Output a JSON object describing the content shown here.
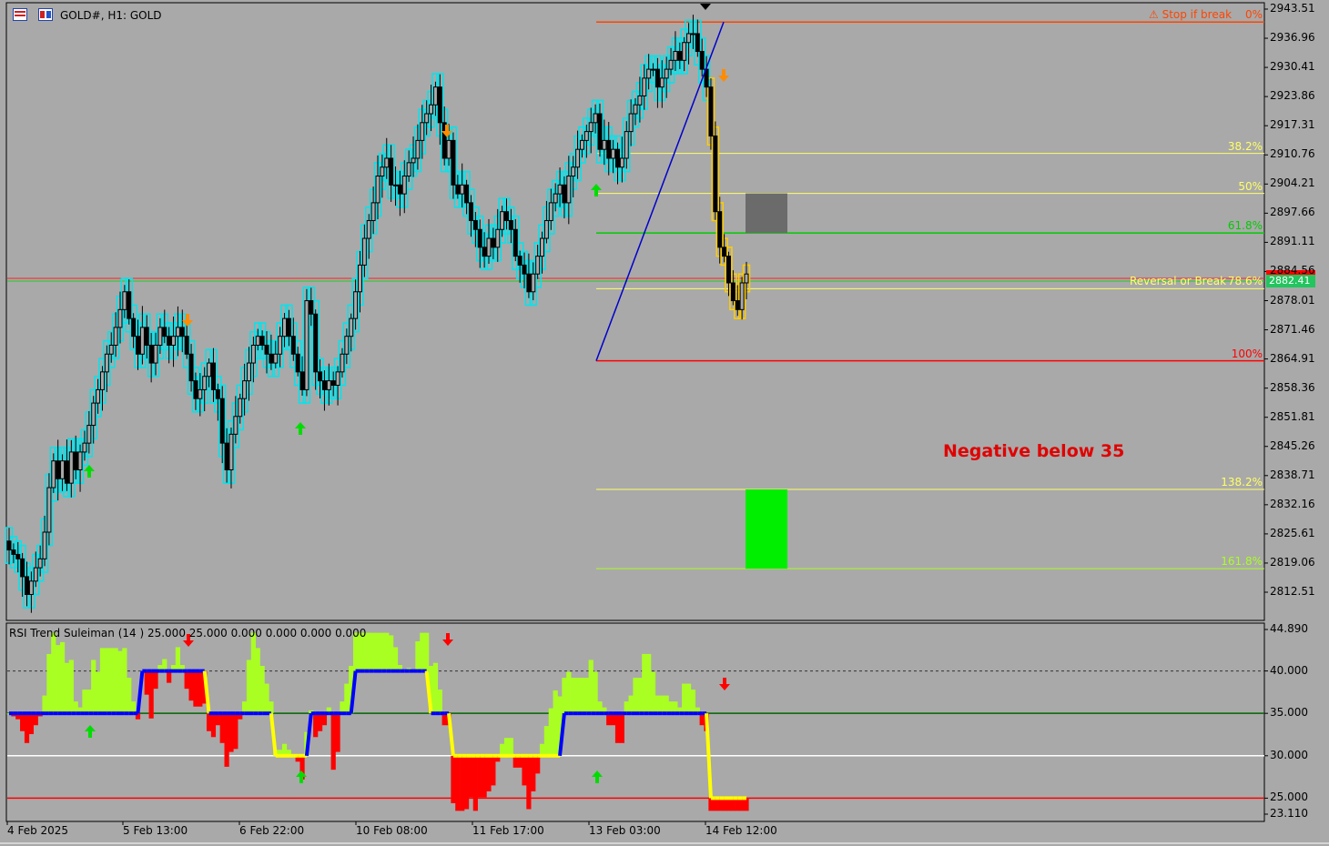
{
  "window": {
    "title": "GOLD#, H1:  GOLD",
    "icons": [
      "chart-window-icon",
      "chart-tile-icon"
    ]
  },
  "colors": {
    "background": "#a9a9a9",
    "envelope": "#00e5ee",
    "candle": "#000000",
    "fib_yellow": "#ffff66",
    "fib_green": "#00cc00",
    "fib_red": "#ff0000",
    "trend_line": "#0000cc",
    "buy_zone": "#00ee00",
    "entry_zone": "#6b6b6b",
    "rsi_positive": "#aaff22",
    "rsi_negative": "#ff0000",
    "rsi_trend_up": "#0000ff",
    "rsi_trend_down": "#ffff00",
    "arrow_up": "#00dd00",
    "arrow_down": "#ff8c00",
    "annotation": "#e00000"
  },
  "price_axis": [
    "2943.51",
    "2936.96",
    "2930.41",
    "2923.86",
    "2917.31",
    "2910.76",
    "2904.21",
    "2897.66",
    "2891.11",
    "2884.56",
    "2878.01",
    "2871.46",
    "2864.91",
    "2858.36",
    "2851.81",
    "2845.26",
    "2838.71",
    "2832.16",
    "2825.61",
    "2819.06",
    "2812.51"
  ],
  "current_price": "2882.41",
  "fibonacci": [
    {
      "pct": "0%",
      "note": "⚠ Stop if break",
      "color": "#ff4500",
      "price": 2940.6
    },
    {
      "pct": "38.2%",
      "note": "",
      "color": "#ffff66",
      "price": 2911.1
    },
    {
      "pct": "50%",
      "note": "",
      "color": "#ffff66",
      "price": 2902.1
    },
    {
      "pct": "61.8%",
      "note": "",
      "color": "#00cc00",
      "price": 2893.2
    },
    {
      "pct": "78.6%",
      "note": "Reversal or Break",
      "color": "#ffff66",
      "price": 2880.7
    },
    {
      "pct": "100%",
      "note": "",
      "color": "#ff0000",
      "price": 2864.5
    },
    {
      "pct": "138.2%",
      "note": "",
      "color": "#ffff66",
      "price": 2835.6
    },
    {
      "pct": "161.8%",
      "note": "",
      "color": "#aaff22",
      "price": 2817.8
    }
  ],
  "annotation": "Negative below 35",
  "oscillator": {
    "title": "RSI Trend Suleiman (14 ) 25.000 25.000 0.000 0.000 0.000 0.000",
    "axis": [
      "44.890",
      "40.000",
      "35.000",
      "30.000",
      "25.000",
      "23.110"
    ],
    "levels": [
      40,
      35,
      30,
      25
    ]
  },
  "time_axis": [
    "4 Feb 2025",
    "5 Feb 13:00",
    "6 Feb 22:00",
    "10 Feb 08:00",
    "11 Feb 17:00",
    "13 Feb 03:00",
    "14 Feb 12:00"
  ],
  "chart_data": {
    "type": "candlestick",
    "series": [
      {
        "values": [
          2822,
          2821,
          2820,
          2816,
          2812,
          2815,
          2818,
          2820,
          2826,
          2836,
          2842,
          2838,
          2842,
          2837,
          2844,
          2840,
          2844,
          2846,
          2850,
          2855,
          2858,
          2862,
          2866,
          2868,
          2872,
          2876,
          2880,
          2874,
          2870,
          2866,
          2872,
          2868,
          2864,
          2868,
          2872,
          2870,
          2868,
          2870,
          2872,
          2870,
          2866,
          2860,
          2856,
          2858,
          2861,
          2864,
          2858,
          2856,
          2846,
          2840,
          2848,
          2852,
          2856,
          2860,
          2864,
          2868,
          2870,
          2868,
          2866,
          2864,
          2866,
          2870,
          2874,
          2870,
          2866,
          2862,
          2858,
          2878,
          2875,
          2862,
          2860,
          2858,
          2860,
          2859,
          2862,
          2866,
          2870,
          2874,
          2880,
          2886,
          2892,
          2896,
          2900,
          2906,
          2908,
          2910,
          2904,
          2904,
          2902,
          2906,
          2909,
          2910,
          2914,
          2918,
          2920,
          2922,
          2926,
          2918,
          2910,
          2914,
          2904,
          2902,
          2904,
          2900,
          2896,
          2894,
          2890,
          2888,
          2892,
          2890,
          2894,
          2898,
          2896,
          2894,
          2888,
          2886,
          2884,
          2880,
          2884,
          2888,
          2892,
          2896,
          2900,
          2902,
          2904,
          2900,
          2906,
          2908,
          2912,
          2914,
          2916,
          2918,
          2920,
          2912,
          2914,
          2910,
          2912,
          2908,
          2910,
          2916,
          2920,
          2922,
          2924,
          2928,
          2930,
          2930,
          2926,
          2928,
          2930,
          2932,
          2934,
          2932,
          2936,
          2938,
          2938,
          2934,
          2930,
          2926,
          2915,
          2898,
          2890,
          2888,
          2882,
          2878,
          2876,
          2882,
          2884
        ]
      }
    ]
  }
}
